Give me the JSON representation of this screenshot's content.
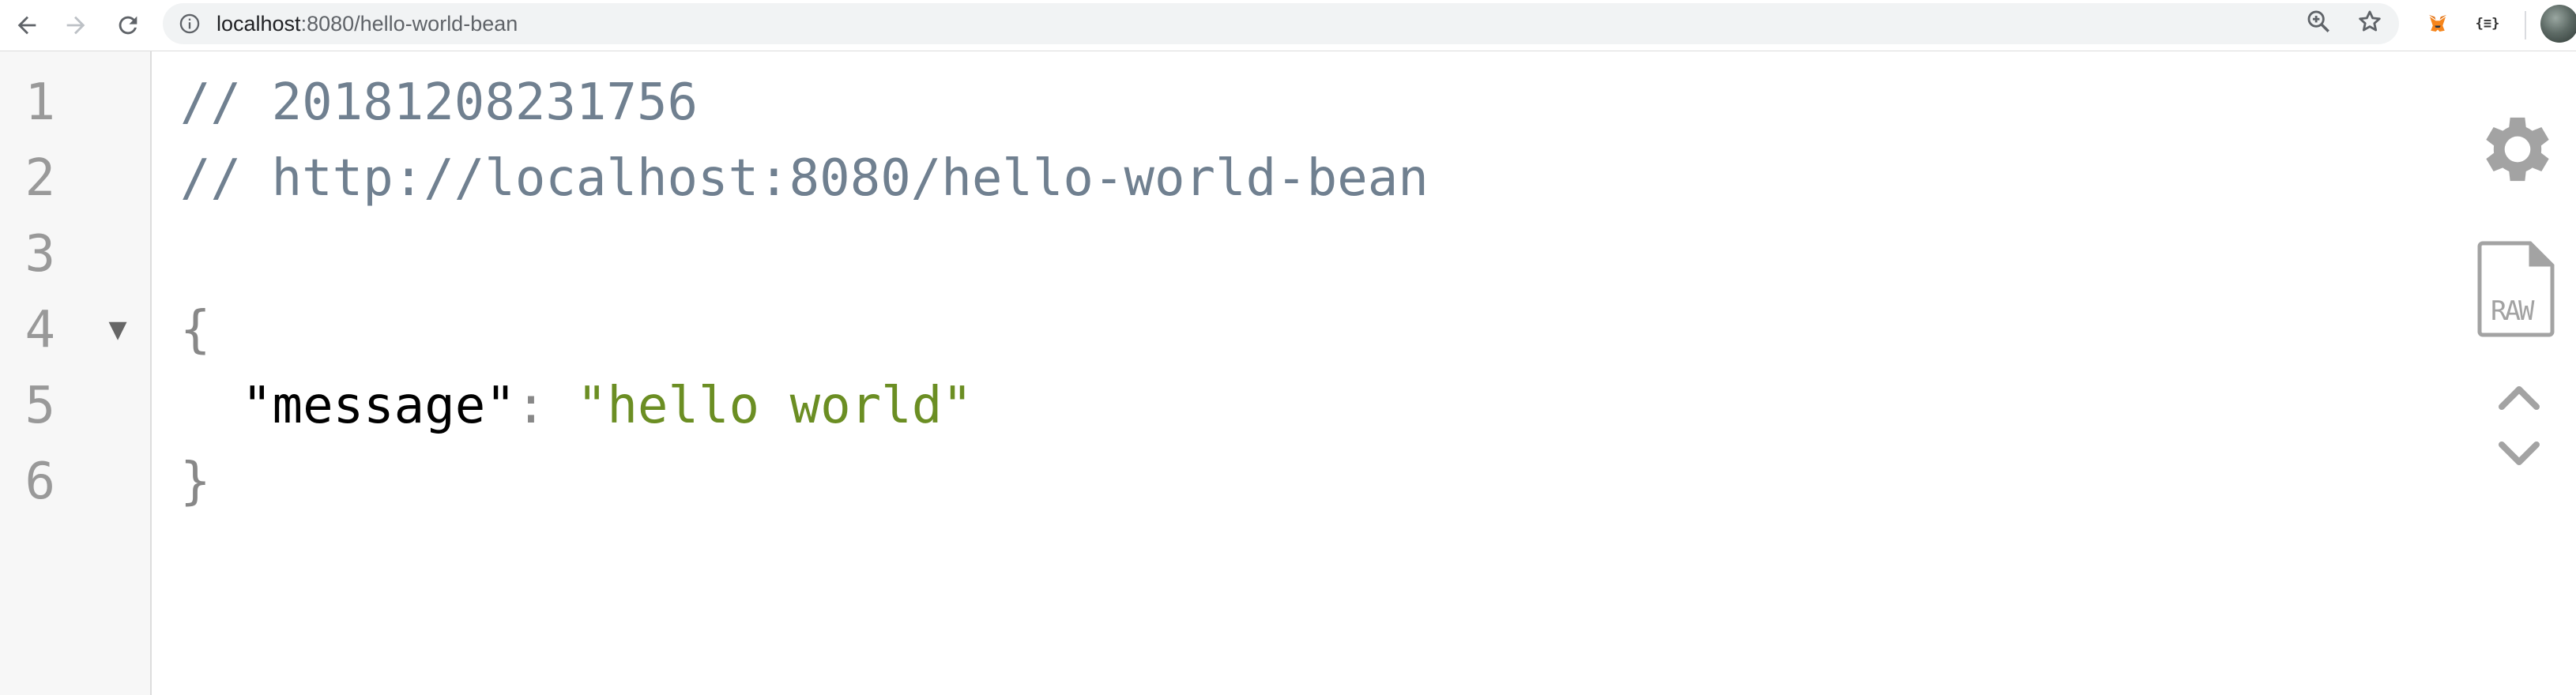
{
  "browser": {
    "url_host": "localhost",
    "url_path": ":8080/hello-world-bean",
    "extensions": [
      {
        "name": "metamask-fox-icon"
      },
      {
        "name": "json-viewer-extension-icon",
        "label": "{≡}"
      }
    ]
  },
  "viewer": {
    "line_numbers": [
      "1",
      "2",
      "3",
      "4",
      "5",
      "6"
    ],
    "comment_timestamp": "// 20181208231756",
    "comment_url": "// http://localhost:8080/hello-world-bean",
    "open_brace": "{",
    "close_brace": "}",
    "json": {
      "key": "\"message\"",
      "colon": ": ",
      "value": "\"hello world\""
    },
    "controls": {
      "raw_label": "RAW"
    }
  },
  "colors": {
    "comment": "#708090",
    "string_value": "#6b8e23",
    "gutter_bg": "#f7f7f7",
    "line_number": "#999999",
    "control_gray": "#a3a3a3"
  }
}
